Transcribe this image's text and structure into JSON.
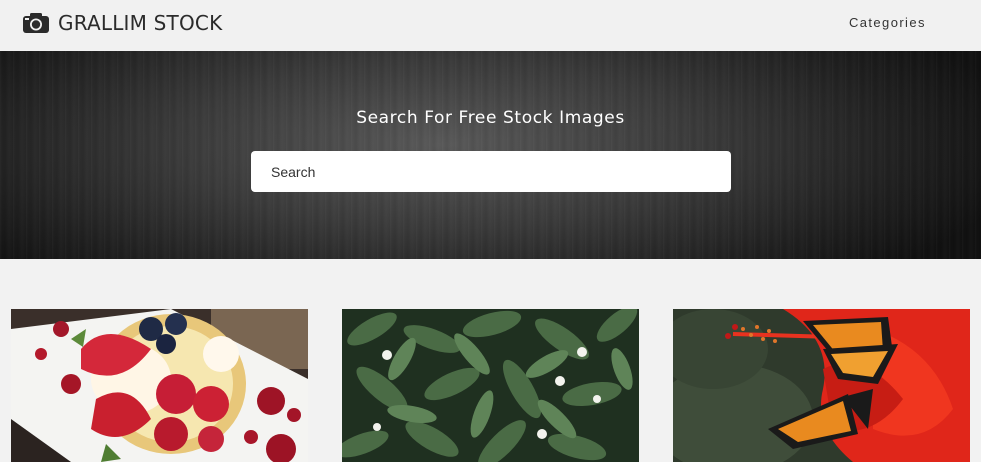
{
  "header": {
    "brand": "GRALLIM STOCK",
    "brand_icon": "camera-icon",
    "nav": {
      "categories": "Categories"
    }
  },
  "hero": {
    "title": "Search For Free Stock Images",
    "search": {
      "placeholder": "Search",
      "value": ""
    }
  },
  "gallery": {
    "items": [
      {
        "image": "berry-tart-photo"
      },
      {
        "image": "green-plant-flowers-photo"
      },
      {
        "image": "butterfly-red-flower-photo"
      }
    ]
  },
  "colors": {
    "header_bg": "#f1f1f1",
    "hero_dark": "#1f1f1f",
    "page_bg": "#f2f2f2",
    "text_dark": "#2b2b2b"
  }
}
